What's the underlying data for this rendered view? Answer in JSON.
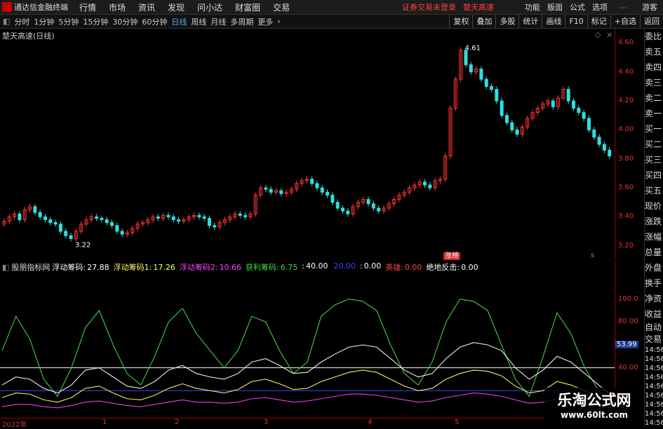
{
  "menubar": {
    "app_title": "通达信金融终端",
    "menus": [
      "行情",
      "市场",
      "资讯",
      "发现",
      "问小达",
      "财富圈",
      "交易"
    ],
    "warning": "证券交易未登录",
    "stock_name": "楚天高速",
    "right_items": [
      "功能",
      "版面",
      "公式",
      "选项"
    ],
    "user": "游客"
  },
  "toolbar": {
    "periods": [
      "分时",
      "1分钟",
      "5分钟",
      "15分钟",
      "30分钟",
      "60分钟",
      "日线",
      "周线",
      "月线",
      "多周期",
      "更多"
    ],
    "active_period": "日线",
    "right_buttons": [
      "复权",
      "叠加",
      "多股",
      "统计",
      "画线",
      "F10",
      "标记",
      "+自选",
      "返回"
    ]
  },
  "price_pane": {
    "title": "楚天高速(日线)",
    "y_ticks": [
      "4.60",
      "4.40",
      "4.20",
      "4.00",
      "3.80",
      "3.60",
      "3.40",
      "3.20"
    ],
    "y_min": 3.15,
    "y_max": 4.65,
    "high_label": "4.61",
    "low_label": "3.22",
    "event_tag": "涨榜",
    "small_tag": "s",
    "colors": {
      "up": "#ff3333",
      "down": "#33dddd",
      "doji": "#ffffff"
    }
  },
  "indicator": {
    "name": "股朋指标网",
    "items": [
      {
        "label": "浮动筹码:",
        "value": "27.88",
        "color": "#ffffff"
      },
      {
        "label": "浮动筹码1:",
        "value": "17.26",
        "color": "#ffff66"
      },
      {
        "label": "浮动筹码2:",
        "value": "10.66",
        "color": "#ff44ff"
      },
      {
        "label": "获利筹码:",
        "value": "6.75",
        "color": "#44dd44"
      },
      {
        "label": ":",
        "value": "40.00",
        "color": "#ffffff"
      },
      {
        "label": "",
        "value": "20.00",
        "color": "#4040ff"
      },
      {
        "label": ":",
        "value": "0.00",
        "color": "#ffffff"
      },
      {
        "label": "英雄:",
        "value": "0.00",
        "color": "#ff4040"
      },
      {
        "label": "绝地反击:",
        "value": "0.00",
        "color": "#ffffff"
      }
    ],
    "y_ticks": [
      "100.0",
      "80.00",
      "40.00"
    ],
    "y_min": 0,
    "y_max": 120,
    "current_badge": "53.99"
  },
  "time_axis": {
    "labels": [
      "2022年",
      "1",
      "2",
      "3",
      "4",
      "5"
    ]
  },
  "right_panel": {
    "items": [
      "委比",
      "卖五",
      "卖四",
      "卖三",
      "卖二",
      "卖一",
      "买一",
      "买二",
      "买三",
      "买四",
      "买五",
      "现价",
      "涨跌",
      "涨幅",
      "总量",
      "外盘",
      "换手",
      "净资",
      "收益",
      "自动",
      "交易",
      "14:56",
      "14:56",
      "14:56",
      "14:56",
      "14:56",
      "14:56",
      "14:56",
      "14:56",
      "14:56"
    ]
  },
  "watermark": {
    "cn": "乐淘公式网",
    "url": "www.60lt.com"
  },
  "chart_data": {
    "type": "candlestick",
    "title": "楚天高速(日线)",
    "closes": [
      3.37,
      3.4,
      3.42,
      3.38,
      3.45,
      3.47,
      3.43,
      3.4,
      3.38,
      3.36,
      3.35,
      3.3,
      3.27,
      3.25,
      3.3,
      3.35,
      3.38,
      3.4,
      3.39,
      3.38,
      3.36,
      3.34,
      3.3,
      3.28,
      3.29,
      3.32,
      3.35,
      3.36,
      3.38,
      3.4,
      3.39,
      3.41,
      3.4,
      3.38,
      3.37,
      3.38,
      3.4,
      3.41,
      3.4,
      3.39,
      3.34,
      3.33,
      3.36,
      3.38,
      3.4,
      3.42,
      3.41,
      3.4,
      3.42,
      3.55,
      3.6,
      3.59,
      3.57,
      3.58,
      3.56,
      3.57,
      3.59,
      3.63,
      3.65,
      3.66,
      3.63,
      3.6,
      3.57,
      3.55,
      3.5,
      3.46,
      3.44,
      3.42,
      3.47,
      3.5,
      3.52,
      3.49,
      3.46,
      3.44,
      3.46,
      3.49,
      3.52,
      3.55,
      3.57,
      3.6,
      3.62,
      3.64,
      3.62,
      3.6,
      3.65,
      3.66,
      3.82,
      4.15,
      4.35,
      4.55,
      4.45,
      4.4,
      4.42,
      4.35,
      4.3,
      4.28,
      4.2,
      4.1,
      4.05,
      4.0,
      3.97,
      4.02,
      4.08,
      4.12,
      4.15,
      4.18,
      4.2,
      4.16,
      4.22,
      4.28,
      4.2,
      4.15,
      4.12,
      4.08,
      4.0,
      3.95,
      3.9,
      3.86,
      3.82
    ],
    "indicator_series": {
      "green": [
        55,
        85,
        65,
        30,
        15,
        40,
        75,
        90,
        60,
        35,
        25,
        50,
        80,
        92,
        70,
        55,
        40,
        55,
        85,
        80,
        55,
        35,
        45,
        85,
        95,
        100,
        98,
        90,
        60,
        35,
        25,
        45,
        80,
        100,
        98,
        90,
        60,
        30,
        15,
        50,
        88,
        70,
        40,
        20,
        8
      ],
      "white": [
        25,
        32,
        30,
        22,
        18,
        25,
        38,
        40,
        32,
        24,
        22,
        28,
        38,
        42,
        35,
        32,
        30,
        35,
        45,
        48,
        42,
        35,
        36,
        45,
        52,
        58,
        60,
        58,
        48,
        38,
        32,
        35,
        48,
        58,
        62,
        60,
        55,
        40,
        30,
        38,
        50,
        45,
        35,
        25,
        15
      ],
      "yellow": [
        14,
        18,
        17,
        12,
        10,
        14,
        22,
        24,
        18,
        13,
        12,
        16,
        22,
        26,
        22,
        20,
        18,
        21,
        28,
        30,
        26,
        21,
        22,
        28,
        32,
        36,
        38,
        36,
        30,
        24,
        20,
        22,
        30,
        35,
        38,
        37,
        33,
        24,
        18,
        20,
        28,
        25,
        20,
        14,
        8
      ],
      "magenta": [
        6,
        8,
        8,
        6,
        5,
        7,
        10,
        11,
        9,
        7,
        6,
        8,
        10,
        12,
        10,
        10,
        9,
        10,
        13,
        14,
        12,
        10,
        11,
        13,
        15,
        17,
        17,
        16,
        14,
        12,
        10,
        11,
        14,
        16,
        18,
        17,
        15,
        12,
        9,
        10,
        13,
        12,
        10,
        7,
        5
      ]
    },
    "reference_lines": [
      40,
      20
    ]
  }
}
